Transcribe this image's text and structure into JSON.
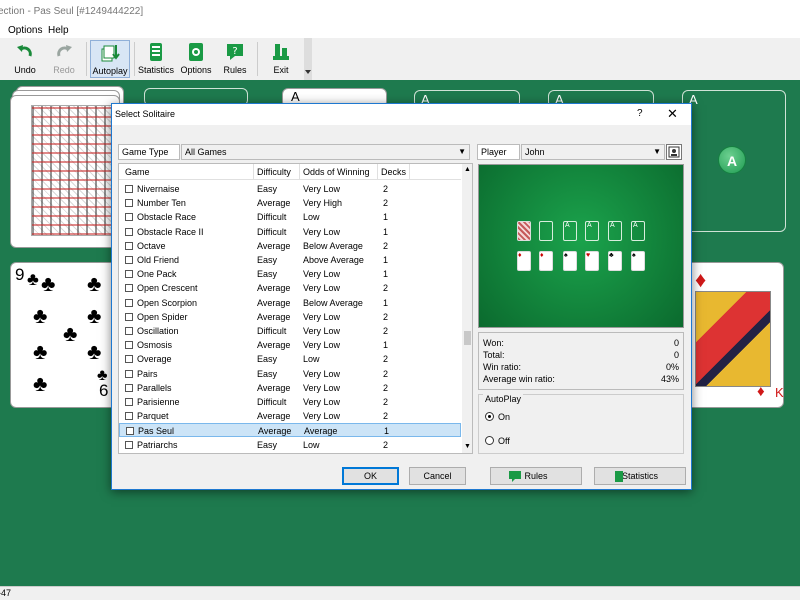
{
  "window": {
    "title": "ection - Pas Seul [#1249444222]"
  },
  "menu": [
    {
      "label": "Options"
    },
    {
      "label": "Help"
    }
  ],
  "toolbar": {
    "undo": "Undo",
    "redo": "Redo",
    "autoplay": "Autoplay",
    "statistics": "Statistics",
    "options": "Options",
    "rules": "Rules",
    "exit": "Exit"
  },
  "table": {
    "card_top_left": "9",
    "card_bottom_right": "6",
    "king_bottom": "K",
    "ace_slots": [
      "A",
      "A",
      "A",
      "A"
    ],
    "ace_button": "A"
  },
  "status": {
    "text": "-47"
  },
  "dialog": {
    "title": "Select Solitaire",
    "help": "?",
    "close": "✕",
    "game_type_label": "Game Type",
    "game_type_value": "All Games",
    "columns": [
      "Game",
      "Difficulty",
      "Odds of Winning",
      "Decks"
    ],
    "games": [
      {
        "name": "Nivernaise",
        "difficulty": "Easy",
        "odds": "Very Low",
        "decks": "2"
      },
      {
        "name": "Number Ten",
        "difficulty": "Average",
        "odds": "Very High",
        "decks": "2"
      },
      {
        "name": "Obstacle Race",
        "difficulty": "Difficult",
        "odds": "Low",
        "decks": "1"
      },
      {
        "name": "Obstacle Race II",
        "difficulty": "Difficult",
        "odds": "Very Low",
        "decks": "1"
      },
      {
        "name": "Octave",
        "difficulty": "Average",
        "odds": "Below Average",
        "decks": "2"
      },
      {
        "name": "Old Friend",
        "difficulty": "Easy",
        "odds": "Above Average",
        "decks": "1"
      },
      {
        "name": "One Pack",
        "difficulty": "Easy",
        "odds": "Very Low",
        "decks": "1"
      },
      {
        "name": "Open Crescent",
        "difficulty": "Average",
        "odds": "Very Low",
        "decks": "2"
      },
      {
        "name": "Open Scorpion",
        "difficulty": "Average",
        "odds": "Below Average",
        "decks": "1"
      },
      {
        "name": "Open Spider",
        "difficulty": "Average",
        "odds": "Very Low",
        "decks": "2"
      },
      {
        "name": "Oscillation",
        "difficulty": "Difficult",
        "odds": "Very Low",
        "decks": "2"
      },
      {
        "name": "Osmosis",
        "difficulty": "Average",
        "odds": "Very Low",
        "decks": "1"
      },
      {
        "name": "Overage",
        "difficulty": "Easy",
        "odds": "Low",
        "decks": "2"
      },
      {
        "name": "Pairs",
        "difficulty": "Easy",
        "odds": "Very Low",
        "decks": "2"
      },
      {
        "name": "Parallels",
        "difficulty": "Average",
        "odds": "Very Low",
        "decks": "2"
      },
      {
        "name": "Parisienne",
        "difficulty": "Difficult",
        "odds": "Very Low",
        "decks": "2"
      },
      {
        "name": "Parquet",
        "difficulty": "Average",
        "odds": "Very Low",
        "decks": "2"
      },
      {
        "name": "Pas Seul",
        "difficulty": "Average",
        "odds": "Average",
        "decks": "1",
        "selected": true
      },
      {
        "name": "Patriarchs",
        "difficulty": "Easy",
        "odds": "Low",
        "decks": "2"
      }
    ],
    "player_label": "Player",
    "player_value": "John",
    "preview_aces": [
      "A",
      "A",
      "A",
      "A"
    ],
    "stats": [
      {
        "label": "Won:",
        "value": "0"
      },
      {
        "label": "Total:",
        "value": "0"
      },
      {
        "label": "Win ratio:",
        "value": "0%"
      },
      {
        "label": "Average win ratio:",
        "value": "43%"
      }
    ],
    "autoplay_title": "AutoPlay",
    "autoplay_on": "On",
    "autoplay_off": "Off",
    "autoplay_selected": "On",
    "ok": "OK",
    "cancel": "Cancel",
    "rules": "Rules",
    "statistics": "Statistics"
  }
}
